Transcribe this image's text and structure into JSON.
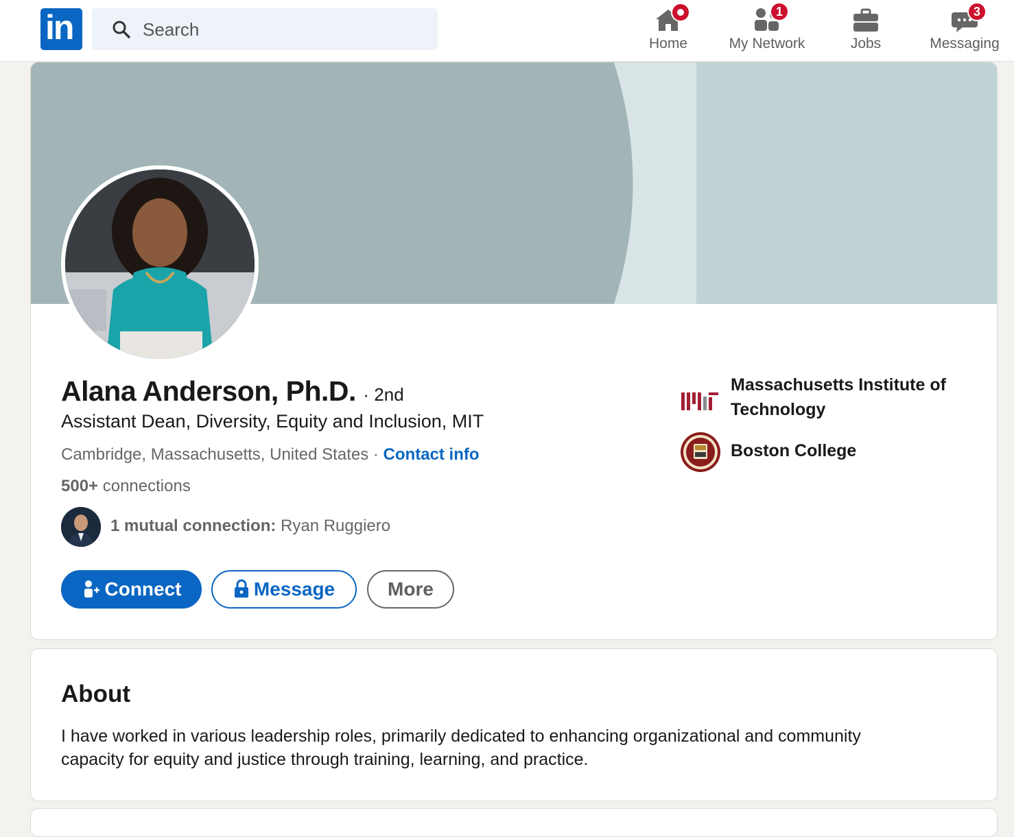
{
  "nav": {
    "logo_text": "in",
    "search_placeholder": "Search",
    "items": [
      {
        "label": "Home",
        "icon": "home-icon",
        "badge": ""
      },
      {
        "label": "My Network",
        "icon": "network-icon",
        "badge": "1"
      },
      {
        "label": "Jobs",
        "icon": "briefcase-icon",
        "badge": ""
      },
      {
        "label": "Messaging",
        "icon": "messaging-icon",
        "badge": "3"
      }
    ]
  },
  "profile": {
    "name": "Alana Anderson, Ph.D.",
    "degree": "· 2nd",
    "headline": "Assistant Dean, Diversity, Equity and Inclusion, MIT",
    "location": "Cambridge, Massachusetts, United States ·",
    "contact_link": "Contact info",
    "connections_count": "500+",
    "connections_label": "connections",
    "mutual_label": "1 mutual connection:",
    "mutual_name": "Ryan Ruggiero",
    "buttons": {
      "connect": "Connect",
      "message": "Message",
      "more": "More"
    },
    "education": [
      {
        "name": "Massachusetts Institute of Technology",
        "logo": "mit-logo"
      },
      {
        "name": "Boston College",
        "logo": "boston-college-seal"
      }
    ]
  },
  "about": {
    "title": "About",
    "text": "I have worked in various leadership roles, primarily dedicated to enhancing organizational and community capacity for equity and justice through training, learning, and practice."
  },
  "colors": {
    "brand": "#0a66c2",
    "badge": "#cb112d",
    "banner_dark": "#a3b4b6",
    "banner_light": "#bfd3d6"
  }
}
